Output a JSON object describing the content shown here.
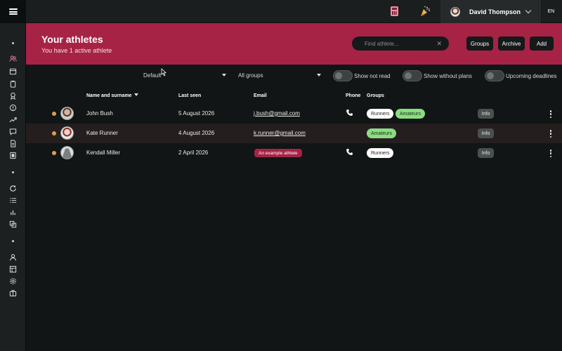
{
  "topbar": {
    "menu_icon": "hamburger-icon",
    "calculator_icon": "calculator-icon",
    "party_icon": "party-popper-icon",
    "user_name": "David Thompson",
    "language": "EN"
  },
  "header": {
    "title": "Your athletes",
    "subtitle": "You have 1 active athlete",
    "search_placeholder": "Find athlete...",
    "search_value": "",
    "clear_symbol": "✕",
    "buttons": {
      "groups": "Groups",
      "archive": "Archive",
      "add": "Add"
    }
  },
  "filters": {
    "sort_selected": "Default",
    "group_selected": "All groups",
    "toggles": [
      {
        "label": "Show not read",
        "on": false
      },
      {
        "label": "Show without plans",
        "on": false
      },
      {
        "label": "Upcoming deadlines",
        "on": false
      }
    ]
  },
  "table": {
    "headers": {
      "name": "Name and surname",
      "last_seen": "Last seen",
      "email": "Email",
      "phone": "Phone",
      "groups": "Groups"
    },
    "rows": [
      {
        "name": "John Bush",
        "last_seen": "5 August 2026",
        "email": "j.bush@gmail.com",
        "has_phone": true,
        "groups": [
          {
            "label": "Runners",
            "style": "white"
          },
          {
            "label": "Amateurs",
            "style": "green"
          }
        ],
        "info": "Info"
      },
      {
        "name": "Kate Runner",
        "last_seen": "4 August 2026",
        "email": "k.runner@gmail.com",
        "has_phone": false,
        "groups": [
          {
            "label": "Amateurs",
            "style": "green"
          }
        ],
        "info": "Info"
      },
      {
        "name": "Kendall Miller",
        "last_seen": "2 April 2026",
        "email_badge": "An example athlete",
        "has_phone": true,
        "groups": [
          {
            "label": "Runners",
            "style": "white"
          }
        ],
        "info": "Info"
      }
    ]
  },
  "colors": {
    "accent": "#a62346",
    "background": "#111515",
    "status_dot": "#d9a050",
    "group_green": "#8cdc82"
  }
}
